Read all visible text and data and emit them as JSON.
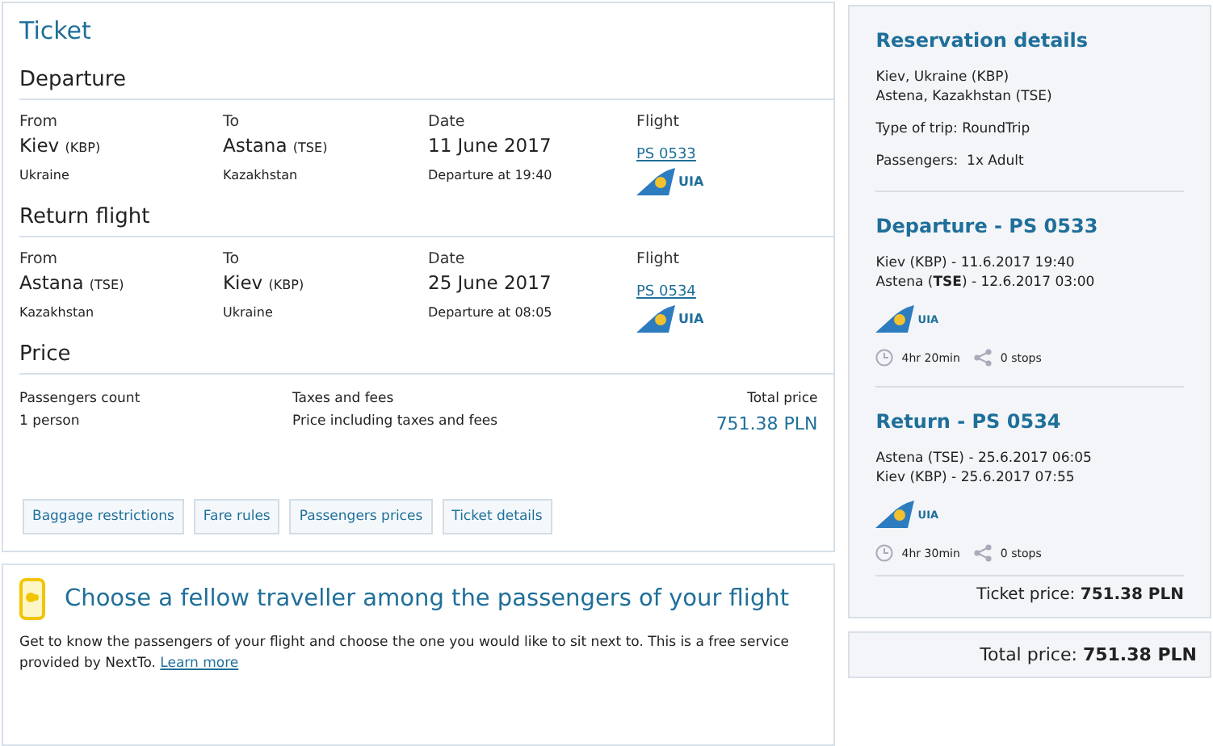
{
  "ticket": {
    "title": "Ticket",
    "legs": [
      {
        "heading": "Departure",
        "labels": [
          "From",
          "To",
          "Date",
          "Flight"
        ],
        "from_city": "Kiev",
        "from_code": "(KBP)",
        "from_country": "Ukraine",
        "to_city": "Astana",
        "to_code": "(TSE)",
        "to_country": "Kazakhstan",
        "date": "11 June 2017",
        "time": "Departure at 19:40",
        "flight": "PS 0533",
        "airline": "UIA"
      },
      {
        "heading": "Return flight",
        "labels": [
          "From",
          "To",
          "Date",
          "Flight"
        ],
        "from_city": "Astana",
        "from_code": "(TSE)",
        "from_country": "Kazakhstan",
        "to_city": "Kiev",
        "to_code": "(KBP)",
        "to_country": "Ukraine",
        "date": "25 June 2017",
        "time": "Departure at 08:05",
        "flight": "PS 0534",
        "airline": "UIA"
      }
    ],
    "price": {
      "heading": "Price",
      "count_label": "Passengers count",
      "count": "1 person",
      "taxes_label": "Taxes and fees",
      "taxes": "Price including taxes and fees",
      "total_label": "Total price",
      "total": "751.38 PLN"
    },
    "buttons": [
      "Baggage restrictions",
      "Fare rules",
      "Passengers prices",
      "Ticket details"
    ]
  },
  "nextto": {
    "title": "Choose a fellow traveller among the passengers of your flight",
    "text": "Get to know the passengers of your flight and choose the one you would like to sit next to. This is a free service provided by NextTo.",
    "link": "Learn more"
  },
  "reservation": {
    "title": "Reservation details",
    "route": [
      "Kiev, Ukraine (KBP)",
      "Astena, Kazakhstan (TSE)"
    ],
    "trip_type": "Type of trip: RoundTrip",
    "passengers": "Passengers:  1x Adult",
    "legs": [
      {
        "title": "Departure - PS 0533",
        "lines": [
          "Kiev (KBP) - 11.6.2017 19:40",
          "Astena (**TSE**) - 12.6.2017 03:00"
        ],
        "airline": "UIA",
        "duration": "4hr 20min",
        "stops": "0 stops"
      },
      {
        "title": "Return - PS 0534",
        "lines": [
          "Astena (TSE) - 25.6.2017 06:05",
          "Kiev (KBP) - 25.6.2017 07:55"
        ],
        "airline": "UIA",
        "duration": "4hr 30min",
        "stops": "0 stops"
      }
    ],
    "ticket_price": "Ticket price: **751.38 PLN**",
    "total_price": "Total price: **751.38 PLN**"
  }
}
